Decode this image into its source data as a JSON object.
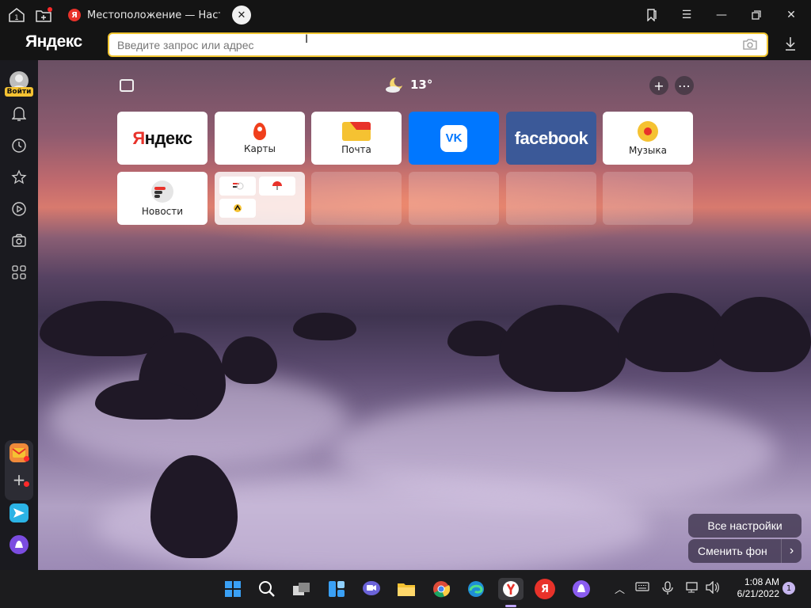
{
  "titlebar": {
    "tab_title": "Местоположение — Наст",
    "tab_favicon": "Я"
  },
  "address_bar": {
    "logo": "Яндекс",
    "placeholder": "Введите запрос или адрес"
  },
  "sidebar": {
    "login_label": "Войти",
    "icons": [
      "bell-icon",
      "history-icon",
      "star-icon",
      "play-icon",
      "camera-icon",
      "apps-icon"
    ]
  },
  "top": {
    "temperature": "13°"
  },
  "tiles": [
    {
      "label": "",
      "logo": "Яндекс"
    },
    {
      "label": "Карты"
    },
    {
      "label": "Почта"
    },
    {
      "label": "",
      "logo": "vk"
    },
    {
      "label": "",
      "logo": "facebook"
    },
    {
      "label": "Музыка"
    },
    {
      "label": "Новости"
    }
  ],
  "buttons": {
    "all_settings": "Все настройки",
    "change_bg": "Сменить фон"
  },
  "taskbar": {
    "time": "1:08 AM",
    "date": "6/21/2022",
    "notifications": "1",
    "yandex_label": "Я"
  },
  "colors": {
    "accent": "#f0c531",
    "vk": "#0077ff",
    "facebook": "#3b5998"
  }
}
